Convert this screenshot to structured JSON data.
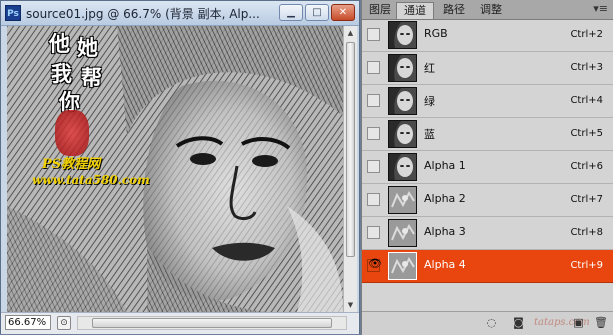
{
  "document": {
    "app_icon": "Ps",
    "title": "source01.jpg @ 66.7% (背景 副本, Alp...",
    "controls": [
      "minimize-icon",
      "maximize-icon",
      "close-icon"
    ],
    "zoom": "66.67%",
    "watermark": {
      "chars": [
        "他",
        "她",
        "我",
        "帮",
        "你"
      ],
      "brand_line1": "PS教程网",
      "brand_line2": "www.tata580.com"
    }
  },
  "channels_panel": {
    "tabs": [
      "图层",
      "通道",
      "路径",
      "调整"
    ],
    "active_tab": "通道",
    "menu_icon": "panel-menu-icon",
    "channels": [
      {
        "name": "RGB",
        "shortcut": "Ctrl+2",
        "visible": false,
        "selected": false
      },
      {
        "name": "红",
        "shortcut": "Ctrl+3",
        "visible": false,
        "selected": false
      },
      {
        "name": "绿",
        "shortcut": "Ctrl+4",
        "visible": false,
        "selected": false
      },
      {
        "name": "蓝",
        "shortcut": "Ctrl+5",
        "visible": false,
        "selected": false
      },
      {
        "name": "Alpha 1",
        "shortcut": "Ctrl+6",
        "visible": false,
        "selected": false
      },
      {
        "name": "Alpha 2",
        "shortcut": "Ctrl+7",
        "visible": false,
        "selected": false
      },
      {
        "name": "Alpha 3",
        "shortcut": "Ctrl+8",
        "visible": false,
        "selected": false
      },
      {
        "name": "Alpha 4",
        "shortcut": "Ctrl+9",
        "visible": true,
        "selected": true
      }
    ],
    "footer_icons": [
      "load-selection-icon",
      "save-selection-icon",
      "new-channel-icon",
      "delete-channel-icon"
    ],
    "footer_watermark": "tataps.com"
  },
  "colors": {
    "selection": "#e8460e",
    "panel_bg": "#d4d4d4",
    "titlebar": "#c9d6e6"
  }
}
